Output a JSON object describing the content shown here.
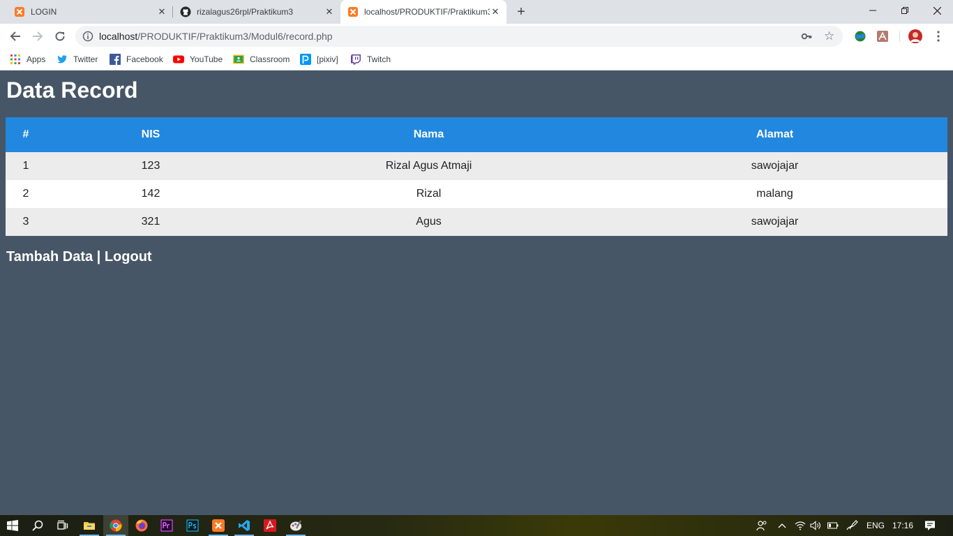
{
  "browser": {
    "tabs": [
      {
        "title": "LOGIN",
        "icon": "xampp-icon"
      },
      {
        "title": "rizalagus26rpl/Praktikum3",
        "icon": "github-icon"
      },
      {
        "title": "localhost/PRODUKTIF/Praktikum3",
        "icon": "xampp-icon",
        "active": true
      }
    ],
    "url_host": "localhost",
    "url_path": "/PRODUKTIF/Praktikum3/Modul6/record.php",
    "bookmarks": [
      {
        "label": "Apps",
        "icon": "apps-grid-icon"
      },
      {
        "label": "Twitter",
        "icon": "twitter-icon"
      },
      {
        "label": "Facebook",
        "icon": "facebook-icon"
      },
      {
        "label": "YouTube",
        "icon": "youtube-icon"
      },
      {
        "label": "Classroom",
        "icon": "classroom-icon"
      },
      {
        "label": "[pixiv]",
        "icon": "pixiv-icon"
      },
      {
        "label": "Twitch",
        "icon": "twitch-icon"
      }
    ]
  },
  "page": {
    "title": "Data Record",
    "table": {
      "headers": [
        "#",
        "NIS",
        "Nama",
        "Alamat"
      ],
      "rows": [
        [
          "1",
          "123",
          "Rizal Agus Atmaji",
          "sawojajar"
        ],
        [
          "2",
          "142",
          "Rizal",
          "malang"
        ],
        [
          "3",
          "321",
          "Agus",
          "sawojajar"
        ]
      ]
    },
    "links": {
      "add": "Tambah Data",
      "separator": " | ",
      "logout": "Logout"
    }
  },
  "taskbar": {
    "language": "ENG",
    "time": "17:16"
  },
  "colors": {
    "page_bg": "#475666",
    "table_header_bg": "#2287de",
    "row_odd_bg": "#ececec",
    "row_even_bg": "#ffffff"
  }
}
